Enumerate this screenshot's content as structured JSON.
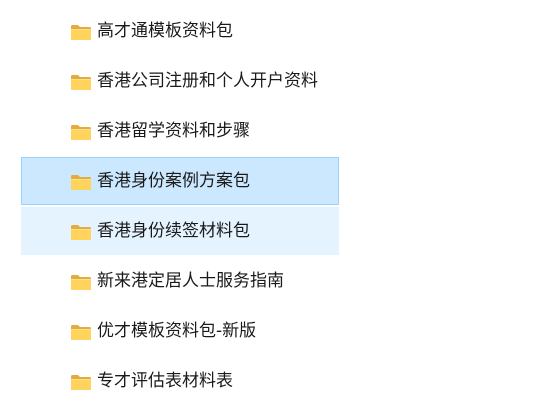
{
  "folders": [
    {
      "label": "高才通模板资料包",
      "icon": "folder-icon",
      "state": "normal"
    },
    {
      "label": "香港公司注册和个人开户资料",
      "icon": "folder-icon",
      "state": "normal"
    },
    {
      "label": "香港留学资料和步骤",
      "icon": "folder-icon",
      "state": "normal"
    },
    {
      "label": "香港身份案例方案包",
      "icon": "folder-icon",
      "state": "selected"
    },
    {
      "label": "香港身份续签材料包",
      "icon": "folder-icon",
      "state": "hover"
    },
    {
      "label": "新来港定居人士服务指南",
      "icon": "folder-icon",
      "state": "normal"
    },
    {
      "label": "优才模板资料包-新版",
      "icon": "folder-icon",
      "state": "normal"
    },
    {
      "label": "专才评估表材料表",
      "icon": "folder-icon",
      "state": "normal"
    }
  ],
  "colors": {
    "selected_bg": "#cce8ff",
    "selected_border": "#99d1ff",
    "hover_bg": "#e5f3ff",
    "folder_back": "#e8b84a",
    "folder_front": "#ffd766"
  }
}
